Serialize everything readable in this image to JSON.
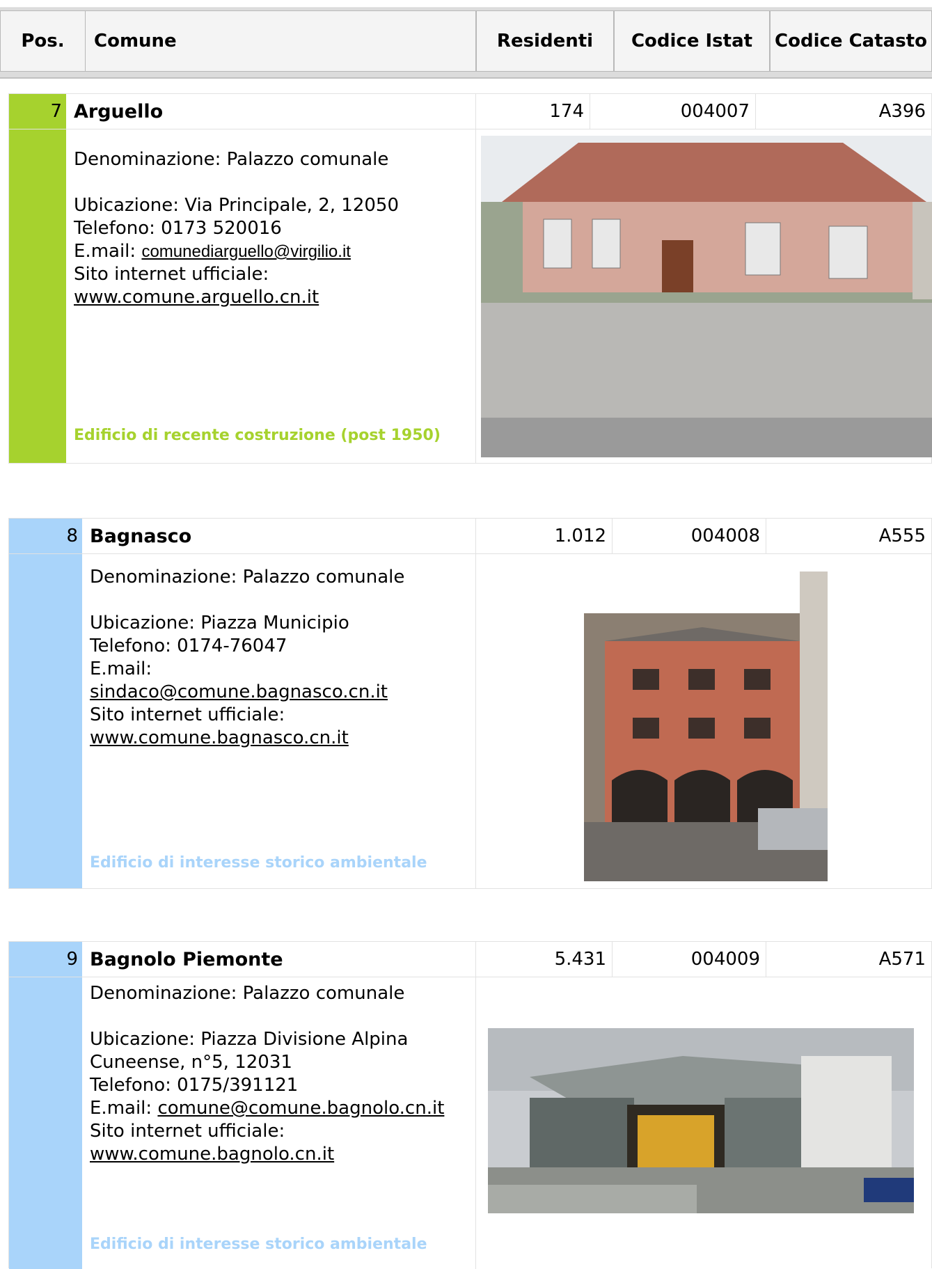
{
  "header": {
    "pos": "Pos.",
    "comune": "Comune",
    "residenti": "Residenti",
    "istat": "Codice Istat",
    "catasto": "Codice Catasto"
  },
  "records": [
    {
      "pos": "7",
      "name": "Arguello",
      "residenti": "174",
      "istat": "004007",
      "catasto": "A396",
      "denominazione": "Denominazione: Palazzo comunale",
      "ubicazione": "Ubicazione: Via Principale, 2, 12050",
      "telefono": "Telefono: 0173 520016",
      "email_label": "E.mail:",
      "email": "comunediarguello@virgilio.it",
      "sito_label": "Sito internet ufficiale:",
      "sito": "www.comune.arguello.cn.it",
      "note": "Edificio di recente costruzione (post 1950)",
      "color": "#a6d22e"
    },
    {
      "pos": "8",
      "name": "Bagnasco",
      "residenti": "1.012",
      "istat": "004008",
      "catasto": "A555",
      "denominazione": "Denominazione: Palazzo comunale",
      "ubicazione": "Ubicazione: Piazza Municipio",
      "telefono": "Telefono: 0174-76047",
      "email_label": "E.mail:",
      "email": "sindaco@comune.bagnasco.cn.it",
      "sito_label": "Sito internet ufficiale:",
      "sito": "www.comune.bagnasco.cn.it",
      "note": "Edificio di interesse storico ambientale",
      "color": "#a9d4fa"
    },
    {
      "pos": "9",
      "name": "Bagnolo Piemonte",
      "residenti": "5.431",
      "istat": "004009",
      "catasto": "A571",
      "denominazione": "Denominazione: Palazzo comunale",
      "ubicazione_1": "Ubicazione: Piazza Divisione Alpina",
      "ubicazione_2": "Cuneense, n°5, 12031",
      "telefono": "Telefono: 0175/391121",
      "email_label": "E.mail:",
      "email": "comune@comune.bagnolo.cn.it",
      "sito_label": "Sito internet ufficiale:",
      "sito": "www.comune.bagnolo.cn.it",
      "note": "Edificio di interesse storico ambientale",
      "color": "#a9d4fa"
    }
  ]
}
